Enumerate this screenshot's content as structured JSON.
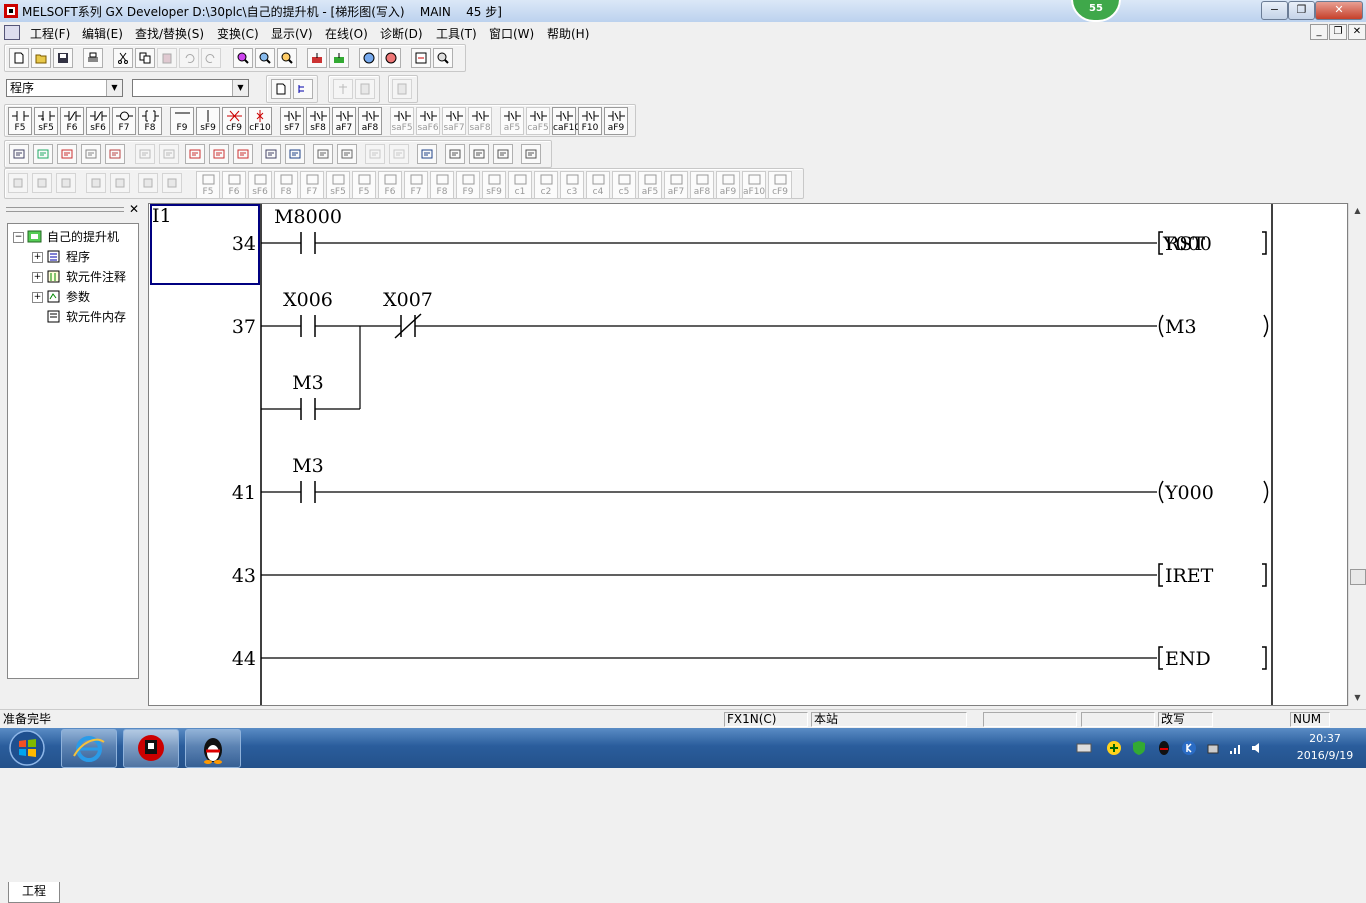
{
  "window": {
    "title": "MELSOFT系列 GX Developer D:\\30plc\\自己的提升机 - [梯形图(写入)    MAIN    45 步]",
    "badge": "55",
    "minimize": "−",
    "restore": "❐",
    "close": "✕"
  },
  "menubar": {
    "items": [
      "工程(F)",
      "编辑(E)",
      "查找/替换(S)",
      "变换(C)",
      "显示(V)",
      "在线(O)",
      "诊断(D)",
      "工具(T)",
      "窗口(W)",
      "帮助(H)"
    ],
    "mdi_min": "_",
    "mdi_restore": "❐",
    "mdi_close": "✕"
  },
  "toolbar": {
    "program_combo": "程序",
    "second_combo": "",
    "ladder_keys": [
      {
        "label": "F5"
      },
      {
        "label": "sF5"
      },
      {
        "label": "F6"
      },
      {
        "label": "sF6"
      },
      {
        "label": "F7"
      },
      {
        "label": "F8"
      },
      {
        "label": "F9"
      },
      {
        "label": "sF9"
      },
      {
        "label": "cF9"
      },
      {
        "label": "cF10"
      },
      {
        "label": "sF7"
      },
      {
        "label": "sF8"
      },
      {
        "label": "aF7"
      },
      {
        "label": "aF8"
      },
      {
        "label": "saF5"
      },
      {
        "label": "saF6"
      },
      {
        "label": "saF7"
      },
      {
        "label": "saF8"
      },
      {
        "label": "aF5"
      },
      {
        "label": "caF5"
      },
      {
        "label": "caF10"
      },
      {
        "label": "F10"
      },
      {
        "label": "aF9"
      }
    ],
    "sfc_keys": [
      {
        "label": "F5"
      },
      {
        "label": "F6"
      },
      {
        "label": "sF6"
      },
      {
        "label": "F8"
      },
      {
        "label": "F7"
      },
      {
        "label": "sF5"
      },
      {
        "label": "F5"
      },
      {
        "label": "F6"
      },
      {
        "label": "F7"
      },
      {
        "label": "F8"
      },
      {
        "label": "F9"
      },
      {
        "label": "sF9"
      },
      {
        "label": "c1"
      },
      {
        "label": "c2"
      },
      {
        "label": "c3"
      },
      {
        "label": "c4"
      },
      {
        "label": "c5"
      },
      {
        "label": "aF5"
      },
      {
        "label": "aF7"
      },
      {
        "label": "aF8"
      },
      {
        "label": "aF9"
      },
      {
        "label": "aF10"
      },
      {
        "label": "cF9"
      }
    ]
  },
  "project_tree": {
    "close": "✕",
    "root": "自己的提升机",
    "items": [
      "程序",
      "软元件注释",
      "参数",
      "软元件内存"
    ],
    "tab": "工程"
  },
  "ladder": {
    "cursor_label": "I1",
    "rungs": [
      {
        "step": "34",
        "contacts": [
          {
            "label": "M8000",
            "type": "NO"
          }
        ],
        "output": {
          "kind": "instr",
          "text": "RST",
          "operand": "Y000"
        }
      },
      {
        "step": "37",
        "contacts": [
          {
            "label": "X006",
            "type": "NO"
          },
          {
            "label": "X007",
            "type": "NC"
          }
        ],
        "branch": {
          "label": "M3",
          "type": "NO"
        },
        "output": {
          "kind": "coil",
          "text": "M3"
        }
      },
      {
        "step": "41",
        "contacts": [
          {
            "label": "M3",
            "type": "NO"
          }
        ],
        "output": {
          "kind": "coil",
          "text": "Y000"
        }
      },
      {
        "step": "43",
        "contacts": [],
        "output": {
          "kind": "instr",
          "text": "IRET"
        }
      },
      {
        "step": "44",
        "contacts": [],
        "output": {
          "kind": "instr",
          "text": "END"
        }
      }
    ]
  },
  "statusbar": {
    "ready": "准备完毕",
    "plc_type": "FX1N(C)",
    "station": "本站",
    "mode": "改写",
    "num": "NUM"
  },
  "taskbar": {
    "time": "20:37",
    "date": "2016/9/19"
  },
  "colors": {
    "ladder_bg": "#ffffff",
    "cursor": "#000080",
    "badge": "#3fa84a",
    "taskbar": "#2a5d9c"
  }
}
